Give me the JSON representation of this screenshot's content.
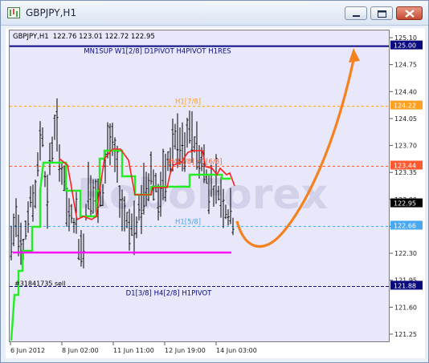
{
  "window": {
    "title": "GBPJPY,H1"
  },
  "chart_header": {
    "symbol": "GBPJPY,H1",
    "ohlc": "122.76 123.01 122.72 122.95"
  },
  "watermark": "RoboForex",
  "levels": [
    {
      "text": "MN1SUP W1[2/8] D1PIVOT H4PIVOT H1RES",
      "price": 125.0,
      "color": "#0a0a80"
    },
    {
      "text": "H1[7/8]",
      "price": 124.22,
      "color": "#ffa020"
    },
    {
      "text": "H4[3/8] H1[6/8]",
      "price": 123.44,
      "color": "#ff5a30"
    },
    {
      "text": "H1[5/8]",
      "price": 122.66,
      "color": "#4aa8f0"
    },
    {
      "text": "D1[3/8] H4[2/8] H1PIVOT",
      "price": 121.88,
      "color": "#0a0a80"
    }
  ],
  "order_label": "#31841735 sell",
  "y_ticks": [
    "125.10",
    "124.75",
    "124.40",
    "124.05",
    "123.70",
    "123.35",
    "123.00",
    "122.65",
    "122.30",
    "121.95",
    "121.60",
    "121.25"
  ],
  "price_badges": [
    {
      "text": "125.00",
      "price": 125.0,
      "color": "#0a0a80"
    },
    {
      "text": "124.22",
      "price": 124.22,
      "color": "#ffa020"
    },
    {
      "text": "123.44",
      "price": 123.44,
      "color": "#ff5a30"
    },
    {
      "text": "122.95",
      "price": 122.95,
      "color": "#000000"
    },
    {
      "text": "122.66",
      "price": 122.66,
      "color": "#4aa8f0"
    },
    {
      "text": "121.88",
      "price": 121.88,
      "color": "#0a0a80"
    }
  ],
  "x_ticks": [
    "6 Jun 2012",
    "8 Jun 02:00",
    "11 Jun 11:00",
    "12 Jun 19:00",
    "14 Jun 03:00"
  ],
  "colors": {
    "plot_bg": "#e8e8fa",
    "bars": "#000000",
    "green_line": "#22ee22",
    "red_line": "#ff2020",
    "magenta_line": "#ff10ff",
    "arrow": "#f58220"
  }
}
